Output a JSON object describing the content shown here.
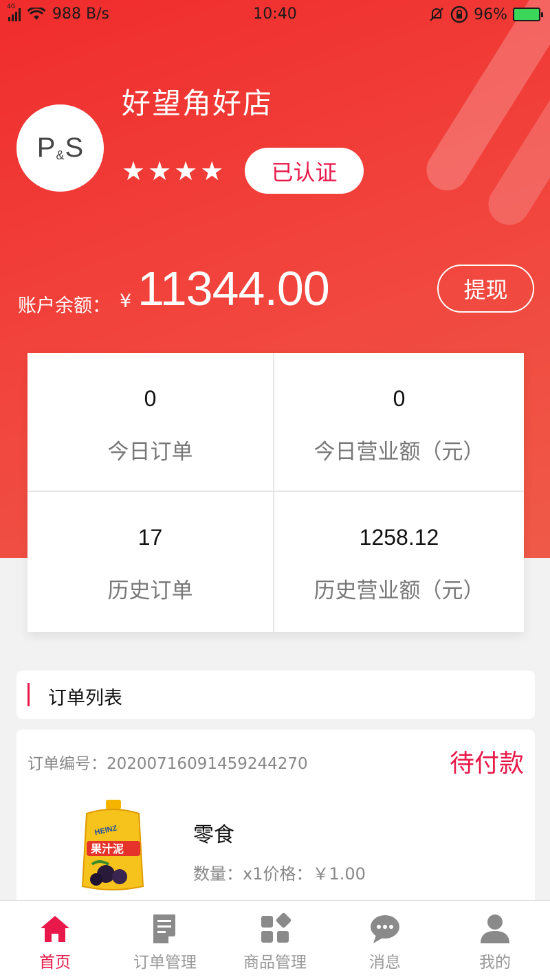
{
  "status_bar": {
    "network_tag": "4G",
    "speed": "988 B/s",
    "time": "10:40",
    "battery": "96%"
  },
  "shop": {
    "avatar_text": "P",
    "avatar_amp": "&",
    "avatar_text2": "S",
    "name": "好望角好店",
    "rating": 4,
    "verified_label": "已认证"
  },
  "balance": {
    "label": "账户余额：",
    "currency": "¥",
    "value": "11344.00",
    "withdraw_label": "提现"
  },
  "stats": [
    {
      "value": "0",
      "label": "今日订单"
    },
    {
      "value": "0",
      "label": "今日营业额（元）"
    },
    {
      "value": "17",
      "label": "历史订单"
    },
    {
      "value": "1258.12",
      "label": "历史营业额（元）"
    }
  ],
  "order_list": {
    "title": "订单列表"
  },
  "order": {
    "number": "订单编号：20200716091459244270",
    "status": "待付款",
    "product_name": "零食",
    "meta": "数量：x1价格：￥1.00",
    "image_brand": "HEINZ",
    "image_label": "果汁泥"
  },
  "tabs": [
    {
      "label": "首页",
      "icon": "home-icon",
      "active": true
    },
    {
      "label": "订单管理",
      "icon": "order-doc-icon",
      "active": false
    },
    {
      "label": "商品管理",
      "icon": "grid-icon",
      "active": false
    },
    {
      "label": "消息",
      "icon": "message-icon",
      "active": false
    },
    {
      "label": "我的",
      "icon": "user-icon",
      "active": false
    }
  ],
  "colors": {
    "brand_red": "#f02c2c",
    "accent": "#e8194a"
  }
}
